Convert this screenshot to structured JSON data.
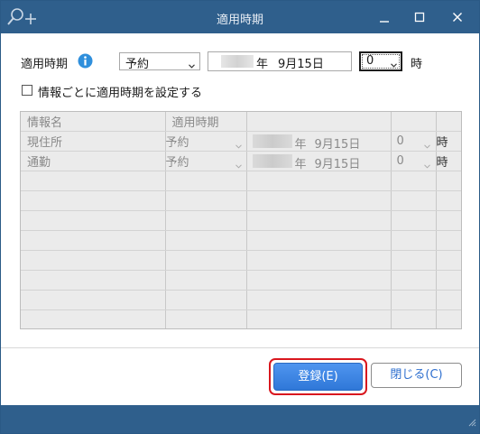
{
  "window": {
    "title": "適用時期",
    "controls": [
      "minimize-icon",
      "maximize-icon",
      "close-icon"
    ]
  },
  "colors": {
    "titlebar": "#2f5f8c",
    "primary_button": "#3a83e3",
    "highlight_ring": "#d9171e",
    "info_icon": "#2f8fdc"
  },
  "period": {
    "label": "適用時期",
    "type_value": "予約",
    "date_year_suffix": "年",
    "date_month_day": "9月15日",
    "hour_value": "0",
    "hour_unit": "時"
  },
  "per_item_checkbox": {
    "label": "情報ごとに適用時期を設定する",
    "checked": false
  },
  "grid": {
    "headers": [
      "情報名",
      "適用時期",
      "",
      "",
      ""
    ],
    "rows": [
      {
        "name": "現住所",
        "type": "予約",
        "year_suffix": "年",
        "month_day": "9月15日",
        "hour": "0",
        "unit": "時"
      },
      {
        "name": "通勤",
        "type": "予約",
        "year_suffix": "年",
        "month_day": "9月15日",
        "hour": "0",
        "unit": "時"
      }
    ]
  },
  "buttons": {
    "register": "登録(E)",
    "close": "閉じる(C)"
  }
}
